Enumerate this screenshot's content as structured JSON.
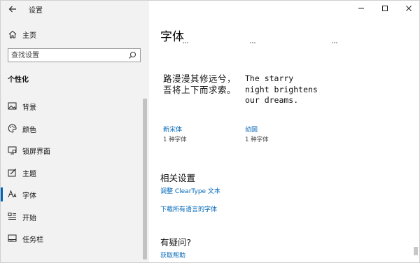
{
  "app": {
    "title": "设置"
  },
  "sidebar": {
    "home_label": "主页",
    "search_placeholder": "查找设置",
    "section_heading": "个性化",
    "items": [
      {
        "label": "背景",
        "icon": "image-icon",
        "active": false
      },
      {
        "label": "颜色",
        "icon": "palette-icon",
        "active": false
      },
      {
        "label": "锁屏界面",
        "icon": "lock-screen-icon",
        "active": false
      },
      {
        "label": "主题",
        "icon": "theme-icon",
        "active": false
      },
      {
        "label": "字体",
        "icon": "font-icon",
        "active": true
      },
      {
        "label": "开始",
        "icon": "start-icon",
        "active": false
      },
      {
        "label": "任务栏",
        "icon": "taskbar-icon",
        "active": false
      }
    ]
  },
  "main": {
    "title": "字体",
    "fonts": [
      {
        "preview": "路漫漫其修远兮，吾将上下而求索。",
        "name": "新宋体",
        "count": "1 种字体",
        "style": "serif"
      },
      {
        "preview": "The starry night brightens our dreams.",
        "name": "幼圆",
        "count": "1 种字体",
        "style": "mono"
      }
    ],
    "related_heading": "相关设置",
    "related_links": [
      "调整 ClearType 文本",
      "下载所有语言的字体"
    ],
    "faq_heading": "有疑问?",
    "help_link": "获取帮助"
  },
  "window_controls": {
    "minimize": "—",
    "maximize": "☐",
    "close": "✕"
  },
  "colors": {
    "accent": "#0067b8",
    "sidebar_bg": "#f2f2f2",
    "indicator": "#0063b1"
  }
}
